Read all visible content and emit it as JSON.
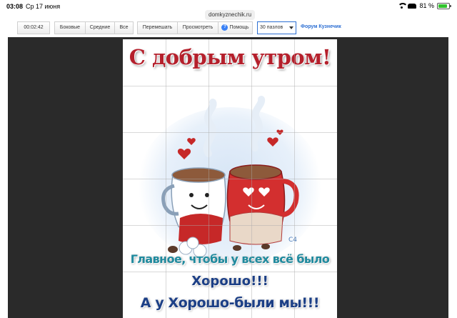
{
  "status": {
    "time": "03:08",
    "date": "Ср 17 июня",
    "url": "domkyznechik.ru",
    "battery": "81 %"
  },
  "toolbar": {
    "timer": "00:02:42",
    "side": "Боковые",
    "middle": "Средние",
    "all": "Все",
    "shuffle": "Перемешать",
    "view": "Просмотреть",
    "help": "Помощь",
    "pieces_select": "30 пазлов",
    "forum": "Форум Кузнечик"
  },
  "puzzle": {
    "title": "С добрым утром!",
    "line1": "Главное, чтобы у всех всё было",
    "line2": "Хорошо!!!",
    "line3": "А у Хорошо-были мы!!!",
    "signature": "С4",
    "grid_cols": 5,
    "grid_rows": 6
  },
  "colors": {
    "board": "#2a2a2a",
    "title": "#b5202c",
    "accent_link": "#2d6fd3",
    "mug_left": "#ffffff",
    "mug_right": "#d32f2f",
    "sweater": "#c62828"
  },
  "icons": [
    "wifi-icon",
    "car-icon",
    "battery-icon",
    "help-icon",
    "chevron-down-icon"
  ]
}
